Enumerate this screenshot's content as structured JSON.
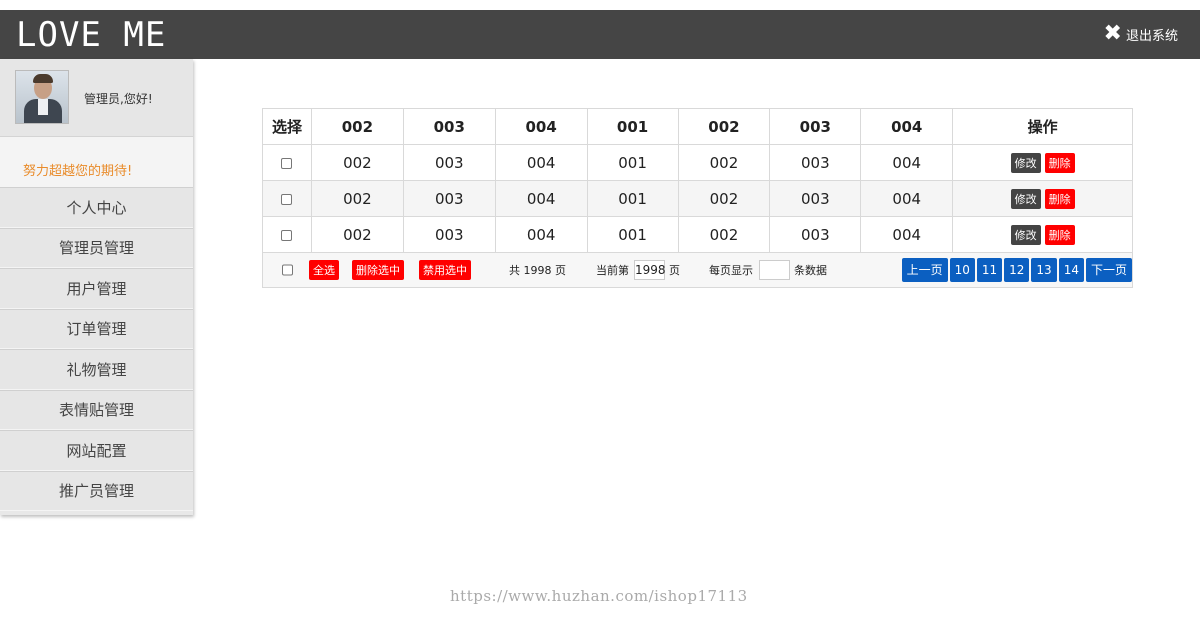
{
  "header": {
    "logo": "LOVE ME",
    "logout_label": "退出系统",
    "logout_icon": "close-icon"
  },
  "sidebar": {
    "greeting": "管理员,您好!",
    "motto": "努力超越您的期待!",
    "items": [
      {
        "label": "个人中心"
      },
      {
        "label": "管理员管理"
      },
      {
        "label": "用户管理"
      },
      {
        "label": "订单管理"
      },
      {
        "label": "礼物管理"
      },
      {
        "label": "表情贴管理"
      },
      {
        "label": "网站配置"
      },
      {
        "label": "推广员管理"
      }
    ]
  },
  "table": {
    "headers": [
      "选择",
      "002",
      "003",
      "004",
      "001",
      "002",
      "003",
      "004",
      "操作"
    ],
    "rows": [
      [
        "002",
        "003",
        "004",
        "001",
        "002",
        "003",
        "004"
      ],
      [
        "002",
        "003",
        "004",
        "001",
        "002",
        "003",
        "004"
      ],
      [
        "002",
        "003",
        "004",
        "001",
        "002",
        "003",
        "004"
      ]
    ],
    "edit_label": "修改",
    "delete_label": "删除"
  },
  "footer": {
    "select_all": "全选",
    "delete_selected": "删除选中",
    "disable_selected": "禁用选中",
    "total_pages": "共 1998 页",
    "current_prefix": "当前第",
    "current_page": "1998",
    "current_suffix": "页",
    "per_page_prefix": "每页显示",
    "per_page_suffix": "条数据",
    "pager": [
      "上一页",
      "10",
      "11",
      "12",
      "13",
      "14",
      "下一页"
    ]
  },
  "watermark": "https://www.huzhan.com/ishop17113",
  "colors": {
    "header_bg": "#454545",
    "danger": "#ff0000",
    "pager": "#0b5fc1",
    "motto": "#e98b2a"
  }
}
